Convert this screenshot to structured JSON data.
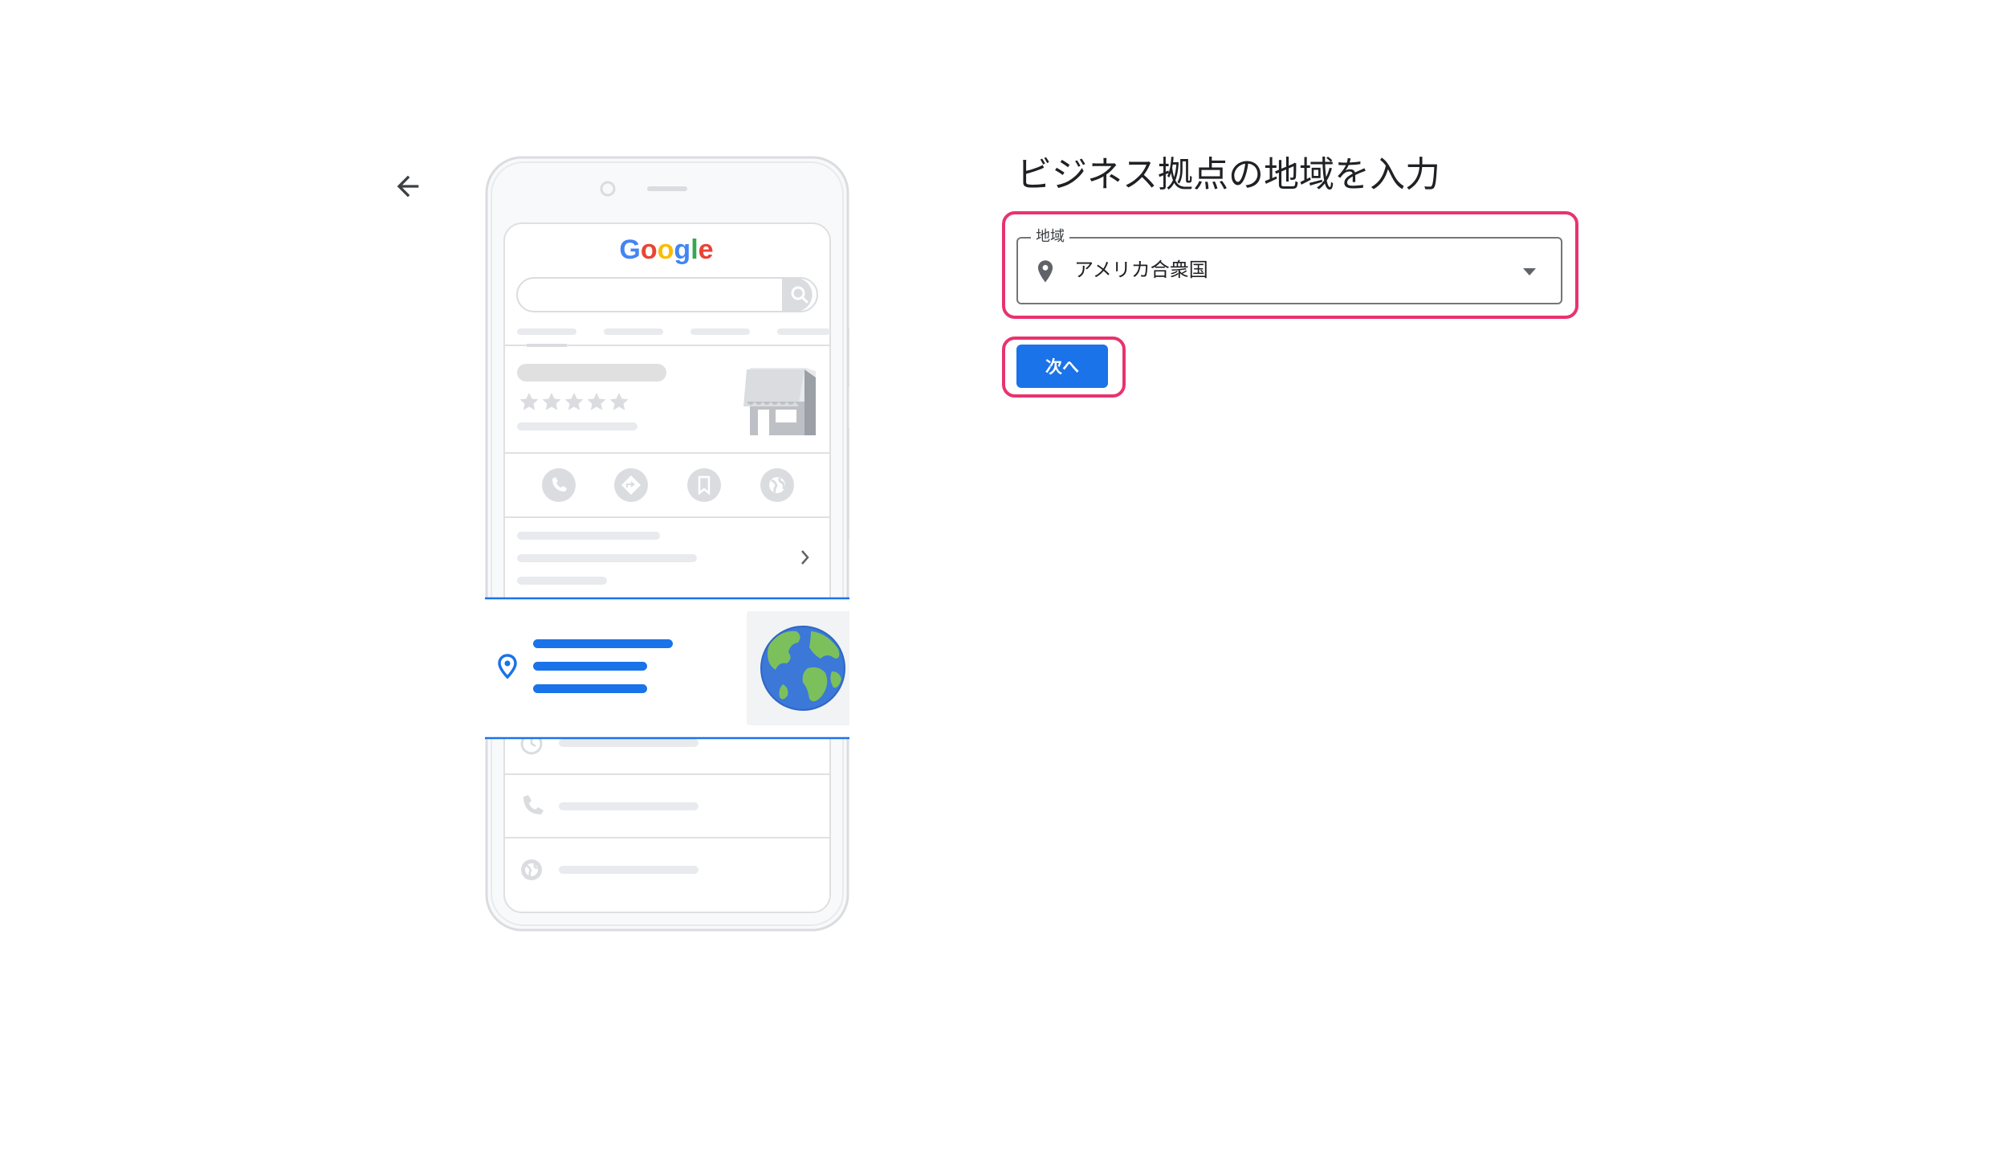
{
  "illustration": {
    "brand": "Google",
    "rating_stars": 5
  },
  "form": {
    "title": "ビジネス拠点の地域を入力",
    "field_label": "地域",
    "field_value": "アメリカ合衆国",
    "next_label": "次へ"
  },
  "icons": {
    "back": "arrow-back-icon",
    "location": "location-pin-icon",
    "dropdown": "dropdown-caret-icon",
    "globe": "globe-icon"
  },
  "colors": {
    "primary": "#1a73e8",
    "highlight": "#e8336e",
    "placeholder_gray": "#dadce0"
  }
}
